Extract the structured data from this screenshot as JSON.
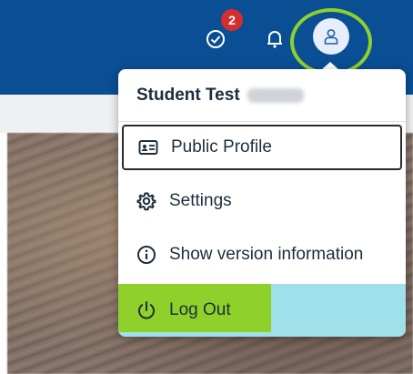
{
  "header": {
    "tasks_badge": "2",
    "icons": {
      "tasks": "check-circle-icon",
      "notifications": "bell-icon",
      "user": "user-icon"
    },
    "colors": {
      "bar": "#0a4e94",
      "badge": "#d32f2f",
      "highlight": "#8fd12a",
      "logout_bg": "#9fe0ea"
    }
  },
  "menu": {
    "user_name": "Student Test",
    "items": [
      {
        "label": "Public Profile",
        "icon": "id-card-icon"
      },
      {
        "label": "Settings",
        "icon": "gear-icon"
      },
      {
        "label": "Show version information",
        "icon": "info-icon"
      },
      {
        "label": "Log Out",
        "icon": "power-icon"
      }
    ]
  }
}
